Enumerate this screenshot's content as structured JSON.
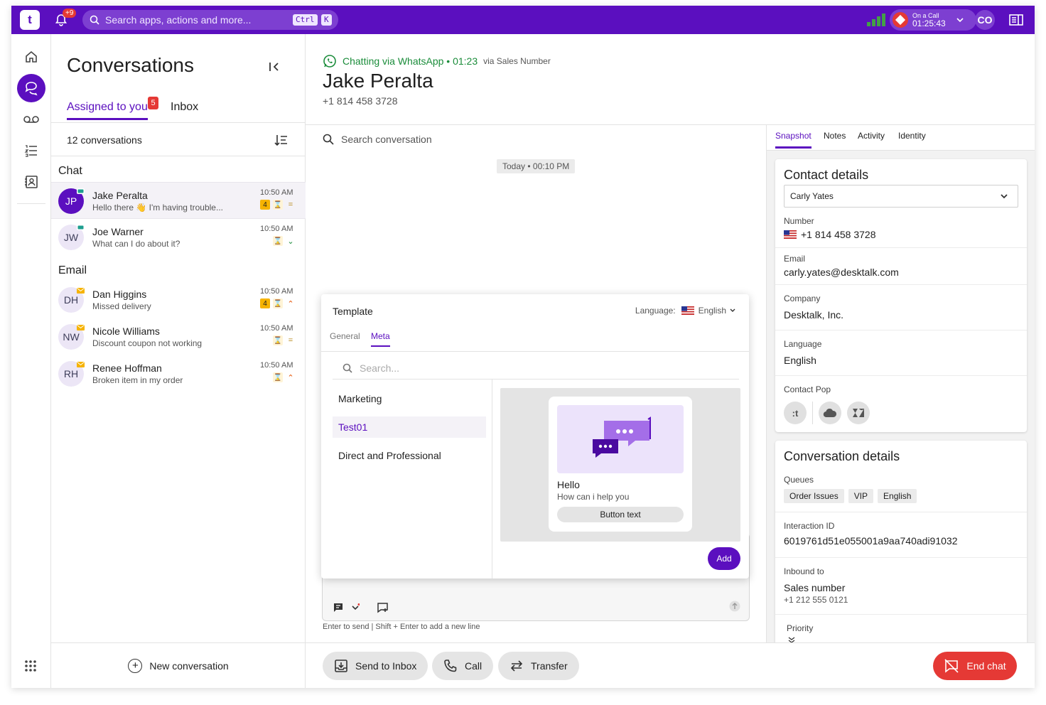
{
  "topbar": {
    "logo": "t",
    "notif_badge": "+9",
    "search_placeholder": "Search apps, actions and more...",
    "kbd_ctrl": "Ctrl",
    "kbd_k": "K",
    "call_label": "On a Call",
    "call_time": "01:25:43",
    "user_initials": "CO",
    "colors": {
      "brand": "#5b0fbf",
      "alert": "#e53935",
      "signal": "#43a047"
    }
  },
  "rail": {
    "items": [
      "home-icon",
      "conversations-icon",
      "voicemail-icon",
      "tasks-icon",
      "contacts-icon"
    ],
    "bottom": "apps-grid-icon"
  },
  "conversations": {
    "title": "Conversations",
    "tabs": {
      "assigned": "Assigned to you",
      "assigned_badge": "5",
      "inbox": "Inbox"
    },
    "count_label": "12 conversations",
    "groups": {
      "chat": "Chat",
      "email": "Email"
    },
    "chat_rows": [
      {
        "initials": "JP",
        "name": "Jake Peralta",
        "preview": "Hello there 👋 I'm having trouble...",
        "time": "10:50 AM",
        "count": "4",
        "priority": "="
      },
      {
        "initials": "JW",
        "name": "Joe Warner",
        "preview": "What can I do about it?",
        "time": "10:50 AM",
        "count": "",
        "priority": "⌄"
      }
    ],
    "email_rows": [
      {
        "initials": "DH",
        "name": "Dan Higgins",
        "preview": "Missed delivery",
        "time": "10:50 AM",
        "count": "4",
        "priority": "⌃"
      },
      {
        "initials": "NW",
        "name": "Nicole Williams",
        "preview": "Discount coupon not working",
        "time": "10:50 AM",
        "count": "",
        "priority": "="
      },
      {
        "initials": "RH",
        "name": "Renee Hoffman",
        "preview": "Broken item in my order",
        "time": "10:50 AM",
        "count": "",
        "priority": "⌃"
      }
    ],
    "new_conversation": "New conversation"
  },
  "chat_header": {
    "channel": "Chatting via WhatsApp • 01:23",
    "via": "via Sales Number",
    "name": "Jake Peralta",
    "phone": "+1 814 458 3728"
  },
  "chat": {
    "search_placeholder": "Search conversation",
    "day_chip": "Today • 00:10 PM",
    "hint": "Enter to send | Shift + Enter to add a new line"
  },
  "template": {
    "title": "Template",
    "language_label": "Language:",
    "language_value": "English",
    "tabs": {
      "general": "General",
      "meta": "Meta"
    },
    "search_placeholder": "Search...",
    "items": [
      "Marketing",
      "Test01",
      "Direct and Professional"
    ],
    "preview": {
      "title": "Hello",
      "subtitle": "How can i help you",
      "button": "Button text"
    },
    "add": "Add"
  },
  "right_panel": {
    "tabs": [
      "Snapshot",
      "Notes",
      "Activity",
      "Identity"
    ],
    "contact": {
      "title": "Contact details",
      "selected": "Carly Yates",
      "number_label": "Number",
      "number": "+1 814 458 3728",
      "email_label": "Email",
      "email": "carly.yates@desktalk.com",
      "company_label": "Company",
      "company": "Desktalk, Inc.",
      "language_label": "Language",
      "language": "English",
      "pop_label": "Contact Pop"
    },
    "conversation": {
      "title": "Conversation details",
      "queues_label": "Queues",
      "queues": [
        "Order Issues",
        "VIP",
        "English"
      ],
      "interaction_label": "Interaction ID",
      "interaction_id": "6019761d51e055001a9aa740adi91032",
      "inbound_label": "Inbound to",
      "inbound": "Sales number",
      "inbound_phone": "+1 212 555 0121",
      "priority_label": "Priority"
    }
  },
  "actions": {
    "send_to_inbox": "Send to Inbox",
    "call": "Call",
    "transfer": "Transfer",
    "end_chat": "End chat"
  }
}
